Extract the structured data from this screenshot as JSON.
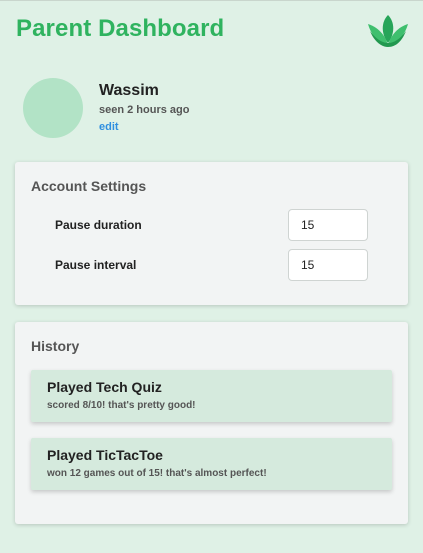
{
  "header": {
    "title": "Parent Dashboard",
    "logo_icon": "lotus-icon",
    "brand_color": "#2fb35f"
  },
  "profile": {
    "name": "Wassim",
    "last_seen": "seen 2 hours ago",
    "edit_label": "edit"
  },
  "settings": {
    "title": "Account Settings",
    "fields": [
      {
        "label": "Pause duration",
        "value": "15"
      },
      {
        "label": "Pause interval",
        "value": "15"
      }
    ]
  },
  "history": {
    "title": "History",
    "items": [
      {
        "title": "Played Tech Quiz",
        "description": "scored 8/10! that's pretty good!"
      },
      {
        "title": "Played TicTacToe",
        "description": "won 12 games out of 15! that's almost perfect!"
      }
    ]
  }
}
